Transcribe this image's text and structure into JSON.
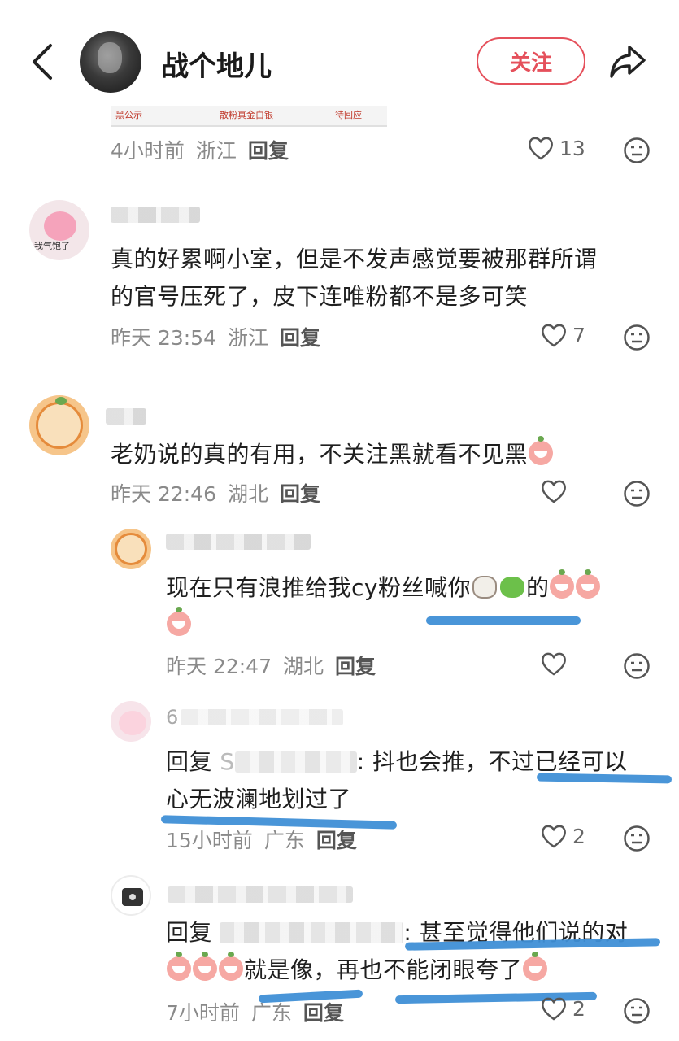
{
  "header": {
    "back_icon": "chevron-left-icon",
    "title": "战个地儿",
    "follow_label": "关注",
    "share_icon": "share-arrow-icon",
    "accent_color": "#e5505b"
  },
  "quoted_image": {
    "labels": [
      "黑公示",
      "散粉真金白银",
      "待回应"
    ]
  },
  "comments": [
    {
      "meta": {
        "time": "4小时前",
        "location": "浙江",
        "reply_label": "回复"
      },
      "likes": "13"
    },
    {
      "avatar_caption": "我气饱了",
      "text_line1": "真的好累啊小室，但是不发声感觉要被那群所谓",
      "text_line2": "的官号压死了，皮下连唯粉都不是多可笑",
      "meta": {
        "time": "昨天 23:54",
        "location": "浙江",
        "reply_label": "回复"
      },
      "likes": "7"
    },
    {
      "text": "老奶说的真的有用，不关注黑就看不见黑",
      "meta": {
        "time": "昨天 22:46",
        "location": "湖北",
        "reply_label": "回复"
      },
      "likes": ""
    }
  ],
  "replies": [
    {
      "text_line1_a": "现在只有浪推给我cy粉丝喊你",
      "text_line1_b": "的",
      "meta": {
        "time": "昨天 22:47",
        "location": "湖北",
        "reply_label": "回复"
      },
      "likes": ""
    },
    {
      "name_fragment": "6",
      "reply_prefix": "回复",
      "reply_name_fragment": "S",
      "text_line1": ": 抖也会推，不过已经可以",
      "text_line2": "心无波澜地划过了",
      "meta": {
        "time": "15小时前",
        "location": "广东",
        "reply_label": "回复"
      },
      "likes": "2"
    },
    {
      "reply_prefix": "回复",
      "text_line1": ": 甚至觉得他们说的对",
      "text_line2": "就是像，再也不能闭眼夸了",
      "meta": {
        "time": "7小时前",
        "location": "广东",
        "reply_label": "回复"
      },
      "likes": "2"
    }
  ],
  "icons": {
    "like": "heart-outline-icon",
    "dislike": "meh-face-icon",
    "emoji_cry": "crying-peach-emoji",
    "emoji_cow": "cow-emoji",
    "emoji_frog": "frog-emoji"
  },
  "highlight_color": "#3f8fd6"
}
